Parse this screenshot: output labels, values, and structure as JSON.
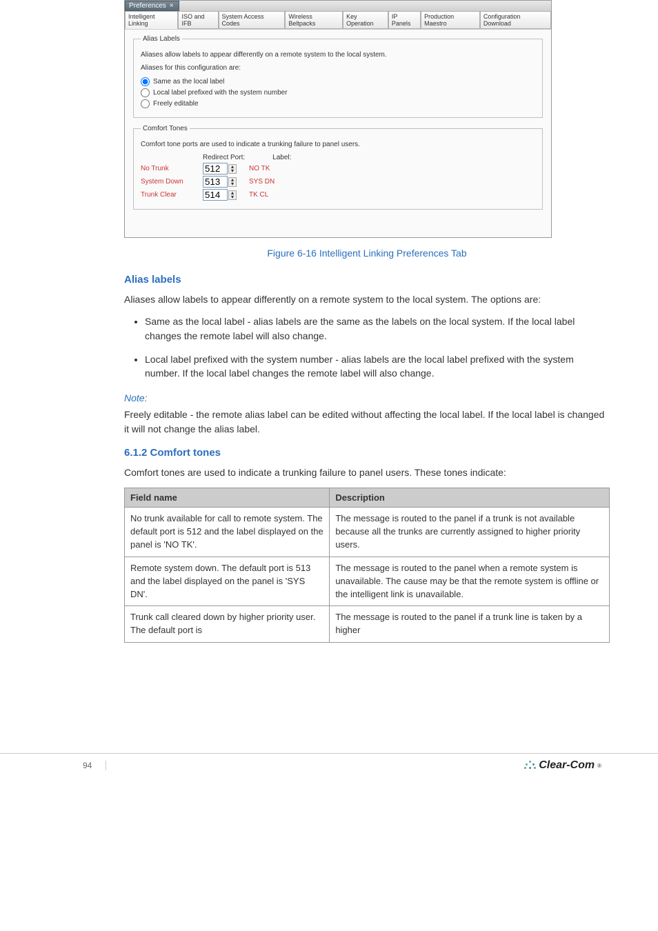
{
  "screenshot": {
    "windowTitle": "Preferences",
    "tabs": [
      "Intelligent Linking",
      "ISO and IFB",
      "System Access Codes",
      "Wireless Beltpacks",
      "Key Operation",
      "IP Panels",
      "Production Maestro",
      "Configuration Download"
    ],
    "aliasLabels": {
      "legend": "Alias Labels",
      "desc1": "Aliases allow labels to appear differently on a remote system to the local system.",
      "desc2": "Aliases for this configuration are:",
      "radios": [
        {
          "label": "Same as the local label",
          "checked": true
        },
        {
          "label": "Local label prefixed with the system number",
          "checked": false
        },
        {
          "label": "Freely editable",
          "checked": false
        }
      ]
    },
    "comfortTones": {
      "legend": "Comfort Tones",
      "desc": "Comfort tone ports are used to indicate a trunking failure to panel users.",
      "header": {
        "port": "Redirect Port:",
        "label": "Label:"
      },
      "rows": [
        {
          "name": "No Trunk",
          "port": "512",
          "label": "NO TK"
        },
        {
          "name": "System Down",
          "port": "513",
          "label": "SYS DN"
        },
        {
          "name": "Trunk Clear",
          "port": "514",
          "label": "TK CL"
        }
      ]
    }
  },
  "figCaption": "Figure 6-16 Intelligent Linking Preferences Tab",
  "sections": {
    "aliasHeading": "Alias labels",
    "aliasPara": "Aliases allow labels to appear differently on a remote system to the local system. The options are:",
    "bullets": [
      "Same as the local label - alias labels are the same as the labels on the local system. If the local label changes the remote label will also change.",
      "Local label prefixed with the system number - alias labels are the local label prefixed with the system number. If the local label changes the remote label will also change."
    ],
    "comfortHeading": "6.1.2 Comfort tones",
    "comfortPara": "Comfort tones are used to indicate a trunking failure to panel users. These tones indicate:",
    "table": {
      "head": [
        "Field name",
        "Description"
      ],
      "rows": [
        [
          "No trunk available for call to remote system. The default port is 512 and the label displayed on the panel is 'NO TK'.",
          "The message is routed to the panel if a trunk is not available because all the trunks are currently assigned to higher priority users."
        ],
        [
          "Remote system down. The default port is 513 and the label displayed on the panel is 'SYS DN'.",
          "The message is routed to the panel when a remote system is unavailable. The cause may be that the remote system is offline or the intelligent link is unavailable."
        ],
        [
          "Trunk call cleared down by higher priority user. The default port is",
          "The message is routed to the panel if a trunk line is taken by a higher"
        ]
      ]
    },
    "noteHdr": "Note:",
    "notePara": "Freely editable - the remote alias label can be edited without affecting the local label. If the local label is changed it will not change the alias label."
  },
  "footer": {
    "page": "94",
    "brand": "Clear-Com"
  }
}
